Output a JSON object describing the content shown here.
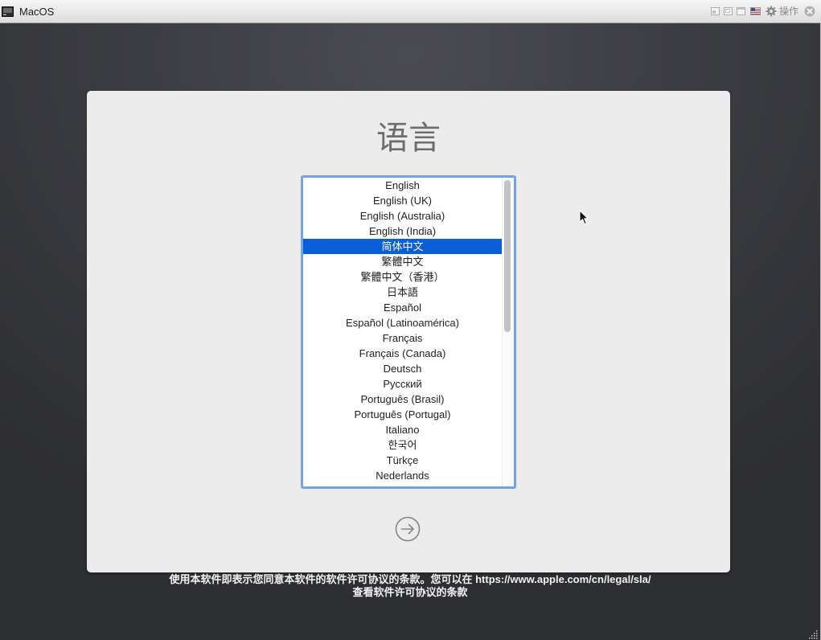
{
  "window": {
    "title": "MacOS",
    "actions_label": "操作"
  },
  "installer": {
    "title": "语言",
    "languages": [
      "English",
      "English (UK)",
      "English (Australia)",
      "English (India)",
      "简体中文",
      "繁體中文",
      "繁體中文（香港）",
      "日本語",
      "Español",
      "Español (Latinoamérica)",
      "Français",
      "Français (Canada)",
      "Deutsch",
      "Русский",
      "Português (Brasil)",
      "Português (Portugal)",
      "Italiano",
      "한국어",
      "Türkçe",
      "Nederlands"
    ],
    "selected_index": 4
  },
  "footer": {
    "line1": "使用本软件即表示您同意本软件的软件许可协议的条款。您可以在 https://www.apple.com/cn/legal/sla/",
    "line2": "查看软件许可协议的条款"
  },
  "colors": {
    "selection": "#0a5fd8",
    "selection_text": "#ffffff",
    "focus_ring": "#73a3e4",
    "panel": "#ececec",
    "footer_text": "#f2f2f2"
  },
  "icons": {
    "app": "app-icon",
    "view_modes": [
      "view-unity-icon",
      "view-scaled-icon",
      "view-windowed-icon"
    ],
    "keyboard_layout": "us-flag-icon",
    "actions": "gear-icon",
    "close": "close-icon",
    "continue": "arrow-right-circle-icon",
    "pointer": "mouse-pointer-icon",
    "resize": "resize-grip-icon"
  }
}
